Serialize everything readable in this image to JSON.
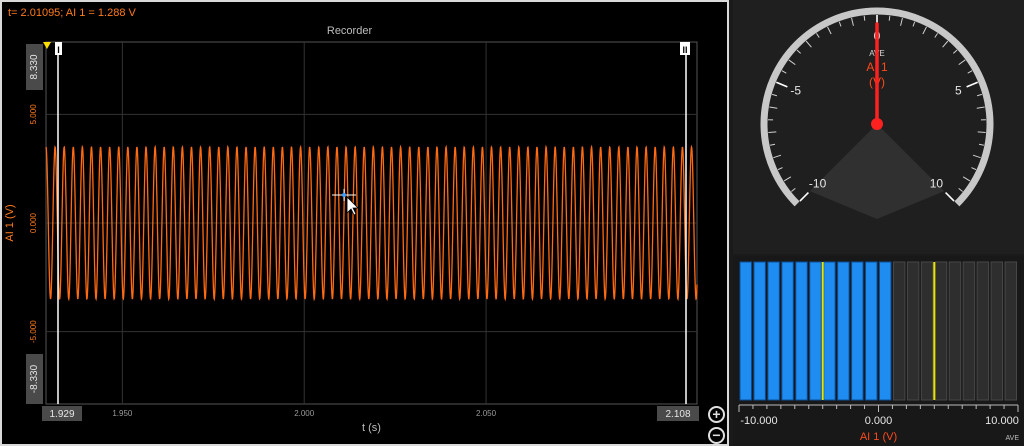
{
  "recorder": {
    "readout": "t= 2.01095; AI 1 = 1.288 V",
    "title": "Recorder",
    "ylabel": "AI 1 (V)",
    "xlabel": "t (s)",
    "y_top_label": "8.330",
    "y_bottom_label": "-8.330",
    "x_left_label": "1.929",
    "x_right_label": "2.108",
    "marker_left": "I",
    "marker_right": "II",
    "zoom_in": "+",
    "zoom_out": "−",
    "colors": {
      "signal": "#ff6a13",
      "axis_text": "#ff7a1a",
      "grid": "#333333",
      "cursor": "#ffffff"
    }
  },
  "chart_data": {
    "type": "line",
    "x": {
      "min": 1.929,
      "max": 2.108,
      "ticks": [
        1.95,
        2.0,
        2.05
      ],
      "tick_labels": [
        "1.950",
        "2.000",
        "2.050"
      ]
    },
    "y": {
      "min": -8.33,
      "max": 8.33,
      "ticks": [
        5.0,
        0.0,
        -5.0
      ],
      "tick_labels": [
        "5.000",
        "0.000",
        "-5.000"
      ]
    },
    "series": [
      {
        "amplitude": 3.5,
        "frequency": 400,
        "phase": 1.5708
      }
    ],
    "grid": true,
    "cursor": {
      "t": 2.01095,
      "value": 1.288
    }
  },
  "gauge": {
    "label_top": "AVE",
    "channel": "AI 1",
    "unit": "(V)",
    "value": 0.0,
    "range": [
      -10,
      10
    ],
    "labels": [
      {
        "value": -10,
        "text": "-10"
      },
      {
        "value": -5,
        "text": "-5"
      },
      {
        "value": 0,
        "text": "0"
      },
      {
        "value": 5,
        "text": "5"
      },
      {
        "value": 10,
        "text": "10"
      }
    ],
    "colors": {
      "needle": "#ff2020",
      "rim": "#c8c8c8",
      "label": "#ff4a1a"
    }
  },
  "bar_meter": {
    "range": [
      -10,
      10
    ],
    "segments": 20,
    "fill_to": 1.0,
    "marker_values": [
      -4.0,
      4.0
    ],
    "tick_labels": [
      "-10.000",
      "0.000",
      "10.000"
    ],
    "channel_label": "AI 1 (V)",
    "ave_label": "AVE",
    "colors": {
      "filled": "#1e8cf0",
      "empty": "#2e2e2e",
      "marker": "#e6e600",
      "label": "#ff4a1a"
    }
  }
}
